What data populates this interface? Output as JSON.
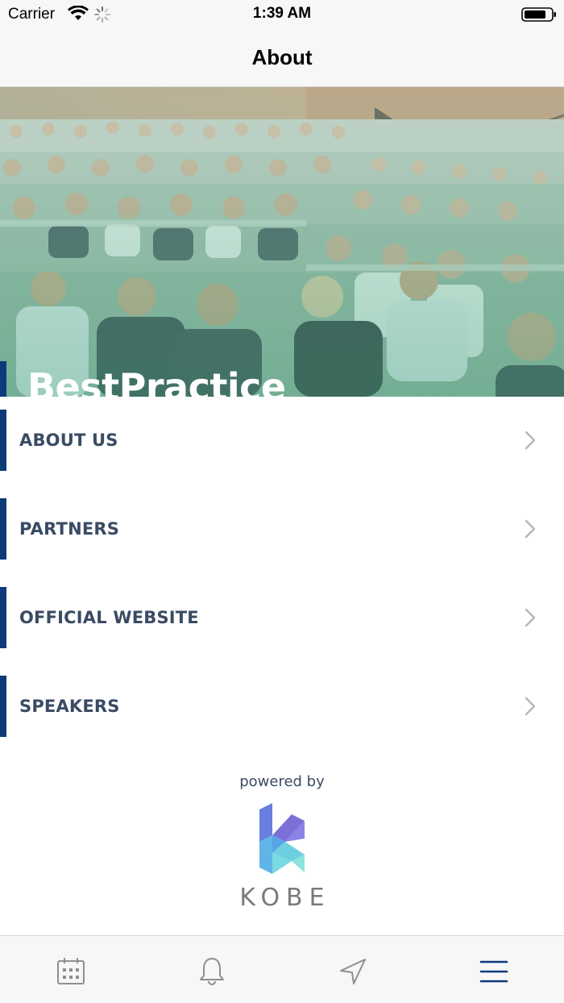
{
  "status_bar": {
    "carrier": "Carrier",
    "time": "1:39 AM",
    "icons": [
      "wifi-icon",
      "loading-spinner-icon",
      "battery-icon"
    ]
  },
  "nav": {
    "title": "About"
  },
  "hero": {
    "title": "BestPractice Day",
    "accent_color": "#0d3b7a"
  },
  "menu": {
    "items": [
      {
        "label": "ABOUT US",
        "icon": "chevron-right-icon"
      },
      {
        "label": "PARTNERS",
        "icon": "chevron-right-icon"
      },
      {
        "label": "OFFICIAL WEBSITE",
        "icon": "chevron-right-icon"
      },
      {
        "label": "SPEAKERS",
        "icon": "chevron-right-icon"
      }
    ]
  },
  "footer": {
    "powered_by": "powered by",
    "brand": "KOBE"
  },
  "tab_bar": {
    "tabs": [
      {
        "icon": "calendar-icon"
      },
      {
        "icon": "bell-icon"
      },
      {
        "icon": "navigation-arrow-icon"
      },
      {
        "icon": "menu-icon",
        "active": true
      }
    ],
    "active_color": "#0d3b7a",
    "inactive_color": "#8e8e93"
  },
  "colors": {
    "accent": "#0d3b7a",
    "menu_text": "#3a4b63",
    "bar_background": "#f7f7f7"
  }
}
